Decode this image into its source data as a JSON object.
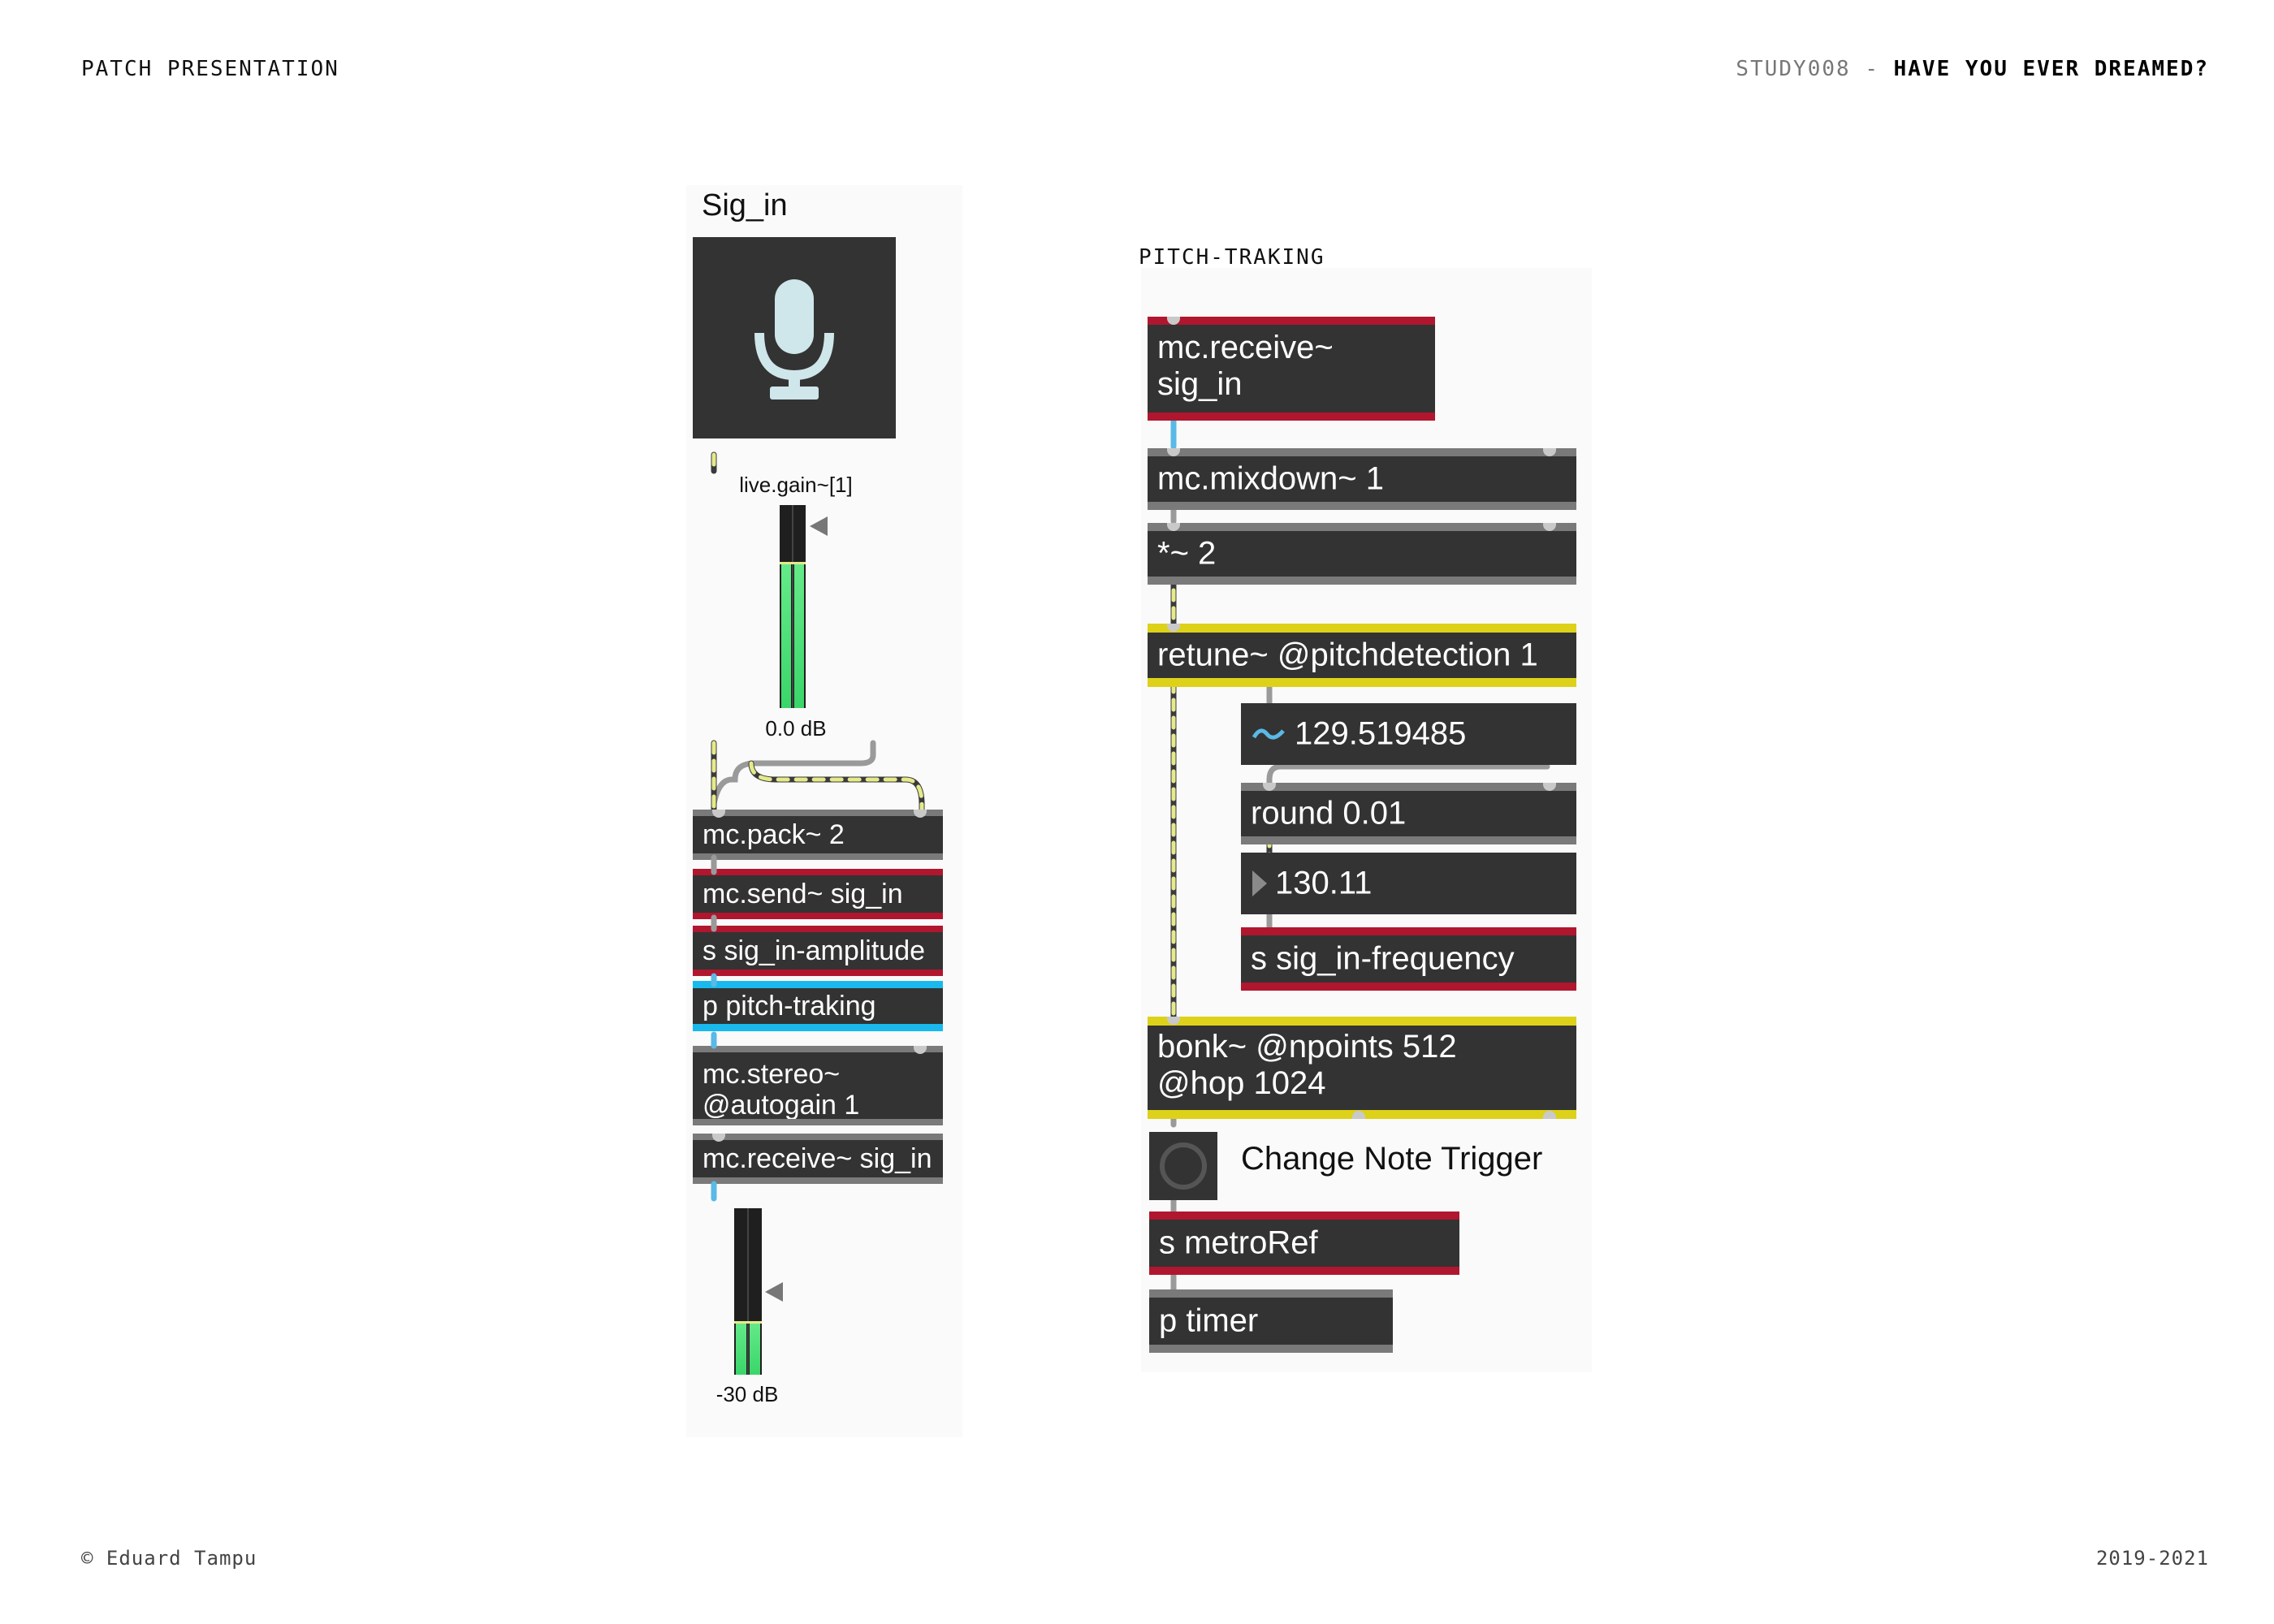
{
  "header": {
    "left": "PATCH PRESENTATION",
    "study": "STUDY008",
    "separator": "-",
    "title": "HAVE YOU EVER DREAMED?"
  },
  "footer": {
    "left": "© Eduard Tampu",
    "right": "2019-2021"
  },
  "left_panel": {
    "title": "Sig_in",
    "mic_icon": "microphone-icon",
    "gain_label": "live.gain~[1]",
    "gain_value": "0.0 dB",
    "gain_level": 0.72,
    "objects": [
      {
        "name": "mc-pack-object",
        "text": "mc.pack~ 2"
      },
      {
        "name": "mc-send-object",
        "text": "mc.send~ sig_in"
      },
      {
        "name": "send-amplitude-object",
        "text": "s sig_in-amplitude"
      },
      {
        "name": "pitch-traking-subpatch",
        "text": "p pitch-traking"
      },
      {
        "name": "mc-stereo-object",
        "line1": "mc.stereo~",
        "line2": "@autogain 1"
      },
      {
        "name": "mc-receive-object",
        "text": "mc.receive~ sig_in"
      }
    ],
    "out_meter_value": "-30 dB",
    "out_meter_level": 0.32
  },
  "right_panel": {
    "title": "PITCH-TRAKING",
    "objects": {
      "receive": {
        "line1": "mc.receive~",
        "line2": "sig_in"
      },
      "mixdown": "mc.mixdown~ 1",
      "multiply": "*~ 2",
      "retune": "retune~ @pitchdetection 1",
      "frequency_number": "129.519485",
      "round": "round 0.01",
      "rounded_number": "130.11",
      "send_frequency": "s sig_in-frequency",
      "bonk": {
        "line1": "bonk~ @npoints 512",
        "line2": "@hop 1024"
      },
      "bang_label": "Change Note Trigger",
      "send_metro": "s metroRef",
      "timer": "p timer"
    }
  },
  "colors": {
    "object_bg": "#333333",
    "send_receive_red": "#b0162e",
    "signal_yellow": "#ddd11a",
    "subpatch_blue": "#19b9ee",
    "meter_green": "#44e47a",
    "mic_icon": "#cfe6ea"
  }
}
